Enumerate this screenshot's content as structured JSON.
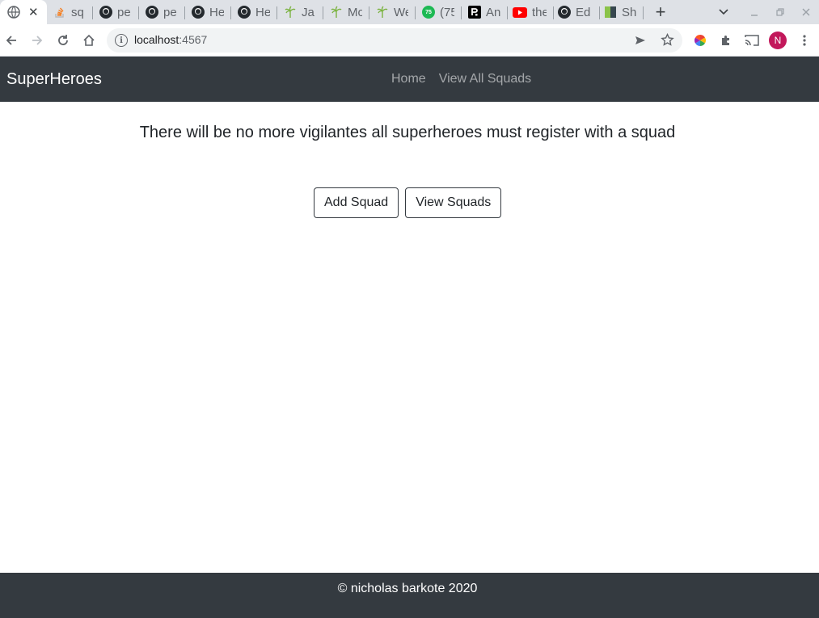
{
  "browser": {
    "active_tab": {
      "favicon": "globe-icon"
    },
    "tabs": [
      {
        "title": "sq",
        "favicon": "stackoverflow-icon",
        "color": "#f48024"
      },
      {
        "title": "pe",
        "favicon": "github-icon",
        "color": "#24292e"
      },
      {
        "title": "pe",
        "favicon": "github-icon",
        "color": "#24292e"
      },
      {
        "title": "He",
        "favicon": "github-icon",
        "color": "#24292e"
      },
      {
        "title": "He",
        "favicon": "github-icon",
        "color": "#24292e"
      },
      {
        "title": "Ja",
        "favicon": "palm-icon",
        "color": "#8bc34a"
      },
      {
        "title": "Mo",
        "favicon": "palm-icon",
        "color": "#8bc34a"
      },
      {
        "title": "We",
        "favicon": "palm-icon",
        "color": "#8bc34a"
      },
      {
        "title": "(75",
        "favicon": "badge-icon",
        "color": "#1db954"
      },
      {
        "title": "An",
        "favicon": "r-logo-icon",
        "color": "#000000"
      },
      {
        "title": "the",
        "favicon": "youtube-icon",
        "color": "#ff0000"
      },
      {
        "title": "Ed",
        "favicon": "github-icon",
        "color": "#24292e"
      },
      {
        "title": "Sh",
        "favicon": "book-icon",
        "color": "#6b8e23"
      }
    ],
    "badge_count": "75",
    "url_host": "localhost",
    "url_port": ":4567",
    "profile_initial": "N"
  },
  "navbar": {
    "brand": "SuperHeroes",
    "links": [
      {
        "label": "Home"
      },
      {
        "label": "View All Squads"
      }
    ]
  },
  "main": {
    "headline": "There will be no more vigilantes all superheroes must register with a squad",
    "buttons": [
      {
        "label": "Add Squad"
      },
      {
        "label": "View Squads"
      }
    ]
  },
  "footer": {
    "text": "© nicholas barkote 2020"
  },
  "colors": {
    "navbar_bg": "#343a40",
    "footer_bg": "#343a40",
    "profile_avatar": "#c2185b"
  }
}
